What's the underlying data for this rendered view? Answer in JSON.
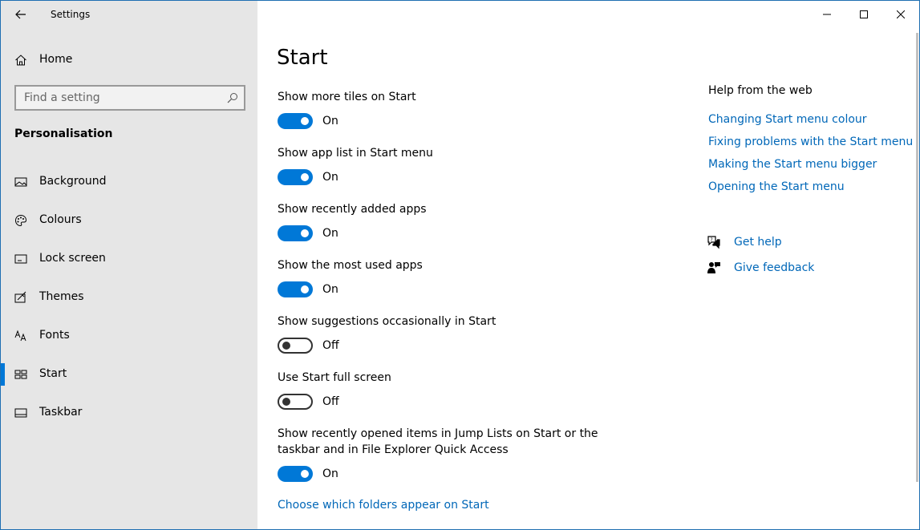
{
  "window": {
    "title": "Settings",
    "controls": {
      "minimize": "minimize",
      "maximize": "maximize",
      "close": "close"
    }
  },
  "sidebar": {
    "home_label": "Home",
    "search_placeholder": "Find a setting",
    "section_title": "Personalisation",
    "items": [
      {
        "label": "Background",
        "icon": "picture-icon",
        "active": false
      },
      {
        "label": "Colours",
        "icon": "palette-icon",
        "active": false
      },
      {
        "label": "Lock screen",
        "icon": "lock-screen-icon",
        "active": false
      },
      {
        "label": "Themes",
        "icon": "themes-icon",
        "active": false
      },
      {
        "label": "Fonts",
        "icon": "fonts-icon",
        "active": false
      },
      {
        "label": "Start",
        "icon": "start-icon",
        "active": true
      },
      {
        "label": "Taskbar",
        "icon": "taskbar-icon",
        "active": false
      }
    ]
  },
  "main": {
    "title": "Start",
    "settings": [
      {
        "label": "Show more tiles on Start",
        "state": "On"
      },
      {
        "label": "Show app list in Start menu",
        "state": "On"
      },
      {
        "label": "Show recently added apps",
        "state": "On"
      },
      {
        "label": "Show the most used apps",
        "state": "On"
      },
      {
        "label": "Show suggestions occasionally in Start",
        "state": "Off"
      },
      {
        "label": "Use Start full screen",
        "state": "Off"
      },
      {
        "label": "Show recently opened items in Jump Lists on Start or the taskbar and in File Explorer Quick Access",
        "state": "On"
      }
    ],
    "folders_link": "Choose which folders appear on Start"
  },
  "help": {
    "title": "Help from the web",
    "links": [
      "Changing Start menu colour",
      "Fixing problems with the Start menu",
      "Making the Start menu bigger",
      "Opening the Start menu"
    ],
    "get_help": "Get help",
    "give_feedback": "Give feedback"
  },
  "colors": {
    "accent": "#0078d7",
    "link": "#0067b8",
    "sidebar_bg": "#e6e6e6"
  }
}
